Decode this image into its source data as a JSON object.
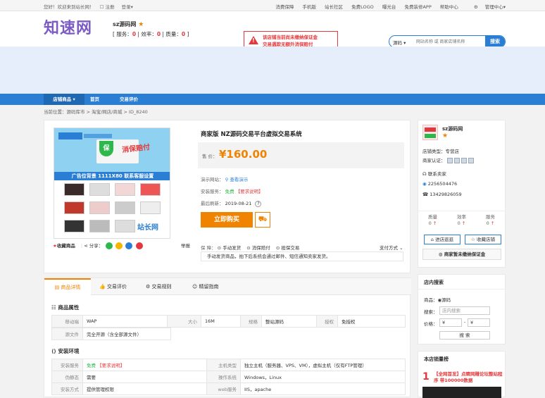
{
  "topbar": {
    "welcome": "您好！欢迎来到站长网！",
    "register": "注册",
    "login": "登录",
    "right_links": [
      "消费保障",
      "手机版",
      "站长社区",
      "免费LOGO",
      "曝光台",
      "免费装修APP",
      "帮助中心",
      "管理中心"
    ]
  },
  "header": {
    "logo": "知速网",
    "shop_name": "sz源码网",
    "stats": {
      "service_label": "服务：",
      "service": "0",
      "efficiency_label": "效率：",
      "efficiency": "0",
      "quality_label": "质量：",
      "quality": "0"
    },
    "warning_line1": "该店铺当前尚未缴纳保证金",
    "warning_line2": "交易遇欺无额外消保赔付",
    "search": {
      "category": "源码",
      "placeholder": "网站名称 或 商家店铺名称",
      "button": "搜索"
    }
  },
  "nav": {
    "items": [
      "店铺商品",
      "首页",
      "交易评价"
    ]
  },
  "breadcrumb": "当前位置：源码库市 > 淘宝/网店/商城 > ID_8240",
  "product": {
    "image": {
      "badge": "保",
      "hero_text": "消保赔付",
      "bar_text": "广告位背景  1111X80  联系客服设置",
      "watermark": "站长网"
    },
    "collect": "收藏商品",
    "share_label": "分享：",
    "report": "举报",
    "title": "商家版 NZ源码交易平台虚拟交易系统",
    "price_label": "售  价：",
    "price": "¥160.00",
    "demo_label": "演示网站：",
    "demo_link": "查看演示",
    "install_label": "安装服务：",
    "install_free": "免费",
    "install_note": "【要求说明】",
    "updated_label": "最后刷新：",
    "updated": "2019-08-21",
    "buy_button": "立即购买",
    "guarantee_label": "保  障：",
    "guarantees": [
      "手动发货",
      "消保赔付",
      "担保交易"
    ],
    "pay_method": "支付方式",
    "notice": "手动发货商品，拍下后系统会通过邮件、短信通知卖家发货。"
  },
  "seller": {
    "name": "sz源码网",
    "type_label": "店铺类型：",
    "type": "专营店",
    "cert_label": "商家认证：",
    "contact": "联系卖家",
    "qq": "2256504476",
    "phone": "13429826059",
    "stats": [
      {
        "label": "质量",
        "value": "0"
      },
      {
        "label": "效率",
        "value": "0"
      },
      {
        "label": "服务",
        "value": "0"
      }
    ],
    "visit_shop": "进店逛逛",
    "collect_shop": "收藏店铺",
    "no_deposit": "商家暂未缴纳保证金"
  },
  "tabs": [
    "商品详情",
    "交易评价",
    "交易规则",
    "精留指南"
  ],
  "attributes": {
    "title": "商品属性",
    "row1": [
      {
        "k": "移动端",
        "v": "WAP"
      },
      {
        "k": "大小",
        "v": "16M"
      },
      {
        "k": "规格",
        "v": "整站源码"
      },
      {
        "k": "授权",
        "v": "免授权"
      }
    ],
    "row2": {
      "k": "源文件",
      "v": "完全开源（含全部源文件）"
    }
  },
  "env": {
    "title": "安装环境",
    "rows": [
      [
        {
          "k": "安装服务",
          "v": "免费",
          "note": "【要求说明】"
        },
        {
          "k": "主机类型",
          "v": "独立主机（服务器、VPS、VM），虚拟主机（仅有FTP管理）"
        }
      ],
      [
        {
          "k": "伪静态",
          "v": "需要"
        },
        {
          "k": "操作系统",
          "v": "Windows，Linux"
        }
      ],
      [
        {
          "k": "安装方式",
          "v": "提供管理权限"
        },
        {
          "k": "web服务",
          "v": "IIS，apache"
        }
      ]
    ]
  },
  "shop_search": {
    "title": "店内搜索",
    "product_label": "商品：",
    "product_option": "源码",
    "keyword_label": "搜索：",
    "keyword_placeholder": "店内搜索",
    "price_label": "价格：",
    "min": "¥",
    "max": "¥",
    "button": "搜 索"
  },
  "ranking": {
    "title": "本店销量榜",
    "first_num": "1",
    "first_title": "【全网首发】点睛网赚论坛整站程序 带100000数据"
  },
  "colors": {
    "primary": "#2a7fd4",
    "accent": "#f08300",
    "danger": "#e4393c",
    "logo": "#7c5cc4"
  }
}
